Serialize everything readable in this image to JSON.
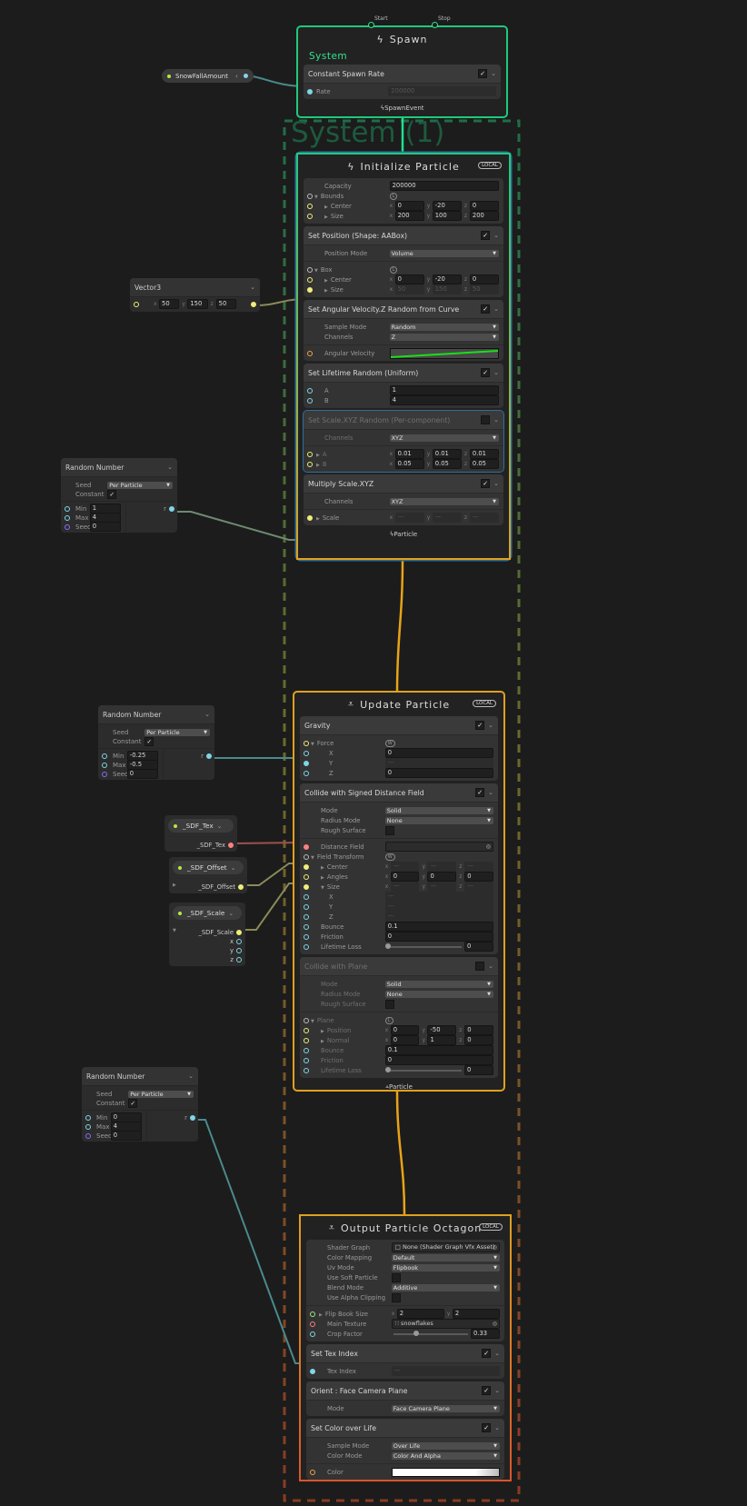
{
  "colors": {
    "flow_spawn": "#1fc97c",
    "flow_particle": "#e8a317",
    "output_bottom": "#d9552a",
    "float_port": "#7fd6e6",
    "vector_port": "#f0ee7a",
    "texture_port": "#ff8080",
    "uint_port": "#8a6cff",
    "vec2_port": "#9fe87a",
    "color_port": "#f5a04a",
    "group_port": "#bbbbbb",
    "selection": "#2f6f9a"
  },
  "system_group_title": "System (1)",
  "snowfall_property": {
    "label": "SnowFallAmount",
    "collapse_icon": "chevron-left-icon"
  },
  "spawn": {
    "title": "Spawn",
    "icon": "lightning-icon",
    "start_label": "Start",
    "stop_label": "Stop",
    "system_label": "System",
    "footer": "SpawnEvent",
    "blocks": [
      {
        "title": "Constant Spawn Rate",
        "enabled": true,
        "rows": [
          {
            "type": "field",
            "label": "Rate",
            "port": "#7fd6e6",
            "filled": true,
            "value": "200000",
            "dim": true
          }
        ]
      }
    ]
  },
  "initialize": {
    "title": "Initialize Particle",
    "icon": "lightning-icon",
    "badge": "LOCAL",
    "footer": "Particle",
    "blocks": [
      {
        "title": "",
        "rows": [
          {
            "type": "field",
            "label": "Capacity",
            "indent": 1,
            "value": "200000"
          },
          {
            "type": "group",
            "label": "Bounds",
            "port": "#bbbbbb",
            "space": "L"
          },
          {
            "type": "vec3",
            "label": "Center",
            "port": "#f0ee7a",
            "indent": 1,
            "expand": "right",
            "x": "0",
            "y": "-20",
            "z": "0"
          },
          {
            "type": "vec3",
            "label": "Size",
            "port": "#f0ee7a",
            "indent": 1,
            "expand": "right",
            "x": "200",
            "y": "100",
            "z": "200"
          }
        ]
      },
      {
        "title": "Set Position (Shape: AABox)",
        "enabled": true,
        "rows": [
          {
            "type": "dropdown",
            "label": "Position Mode",
            "indent": 1,
            "value": "Volume"
          },
          {
            "type": "sep"
          },
          {
            "type": "group",
            "label": "Box",
            "port": "#bbbbbb",
            "space": "L"
          },
          {
            "type": "vec3",
            "label": "Center",
            "port": "#f0ee7a",
            "indent": 1,
            "expand": "right",
            "x": "0",
            "y": "-20",
            "z": "0"
          },
          {
            "type": "vec3",
            "label": "Size",
            "port": "#f0ee7a",
            "filled": true,
            "indent": 1,
            "expand": "right",
            "x": "50",
            "y": "150",
            "z": "50",
            "dim": true
          }
        ]
      },
      {
        "title": "Set Angular Velocity.Z Random from Curve",
        "enabled": true,
        "rows": [
          {
            "type": "dropdown",
            "label": "Sample Mode",
            "indent": 1,
            "value": "Random"
          },
          {
            "type": "dropdown",
            "label": "Channels",
            "indent": 1,
            "value": "Z"
          },
          {
            "type": "sep"
          },
          {
            "type": "curve",
            "label": "Angular Velocity",
            "port": "#f5a04a",
            "indent": 1,
            "curve_color": "#19e019"
          }
        ]
      },
      {
        "title": "Set Lifetime Random (Uniform)",
        "enabled": true,
        "rows": [
          {
            "type": "field",
            "label": "A",
            "port": "#7fd6e6",
            "indent": 1,
            "value": "1"
          },
          {
            "type": "field",
            "label": "B",
            "port": "#7fd6e6",
            "indent": 1,
            "value": "4"
          }
        ]
      },
      {
        "title": "Set Scale.XYZ Random (Per-component)",
        "enabled": false,
        "selected": true,
        "rows": [
          {
            "type": "dropdown",
            "label": "Channels",
            "indent": 1,
            "value": "XYZ"
          },
          {
            "type": "sep"
          },
          {
            "type": "vec3",
            "label": "A",
            "port": "#f0ee7a",
            "expand": "right",
            "x": "0.01",
            "y": "0.01",
            "z": "0.01"
          },
          {
            "type": "vec3",
            "label": "B",
            "port": "#f0ee7a",
            "expand": "right",
            "x": "0.05",
            "y": "0.05",
            "z": "0.05"
          }
        ]
      },
      {
        "title": "Multiply Scale.XYZ",
        "enabled": true,
        "rows": [
          {
            "type": "dropdown",
            "label": "Channels",
            "indent": 1,
            "value": "XYZ"
          },
          {
            "type": "sep"
          },
          {
            "type": "vec3",
            "label": "Scale",
            "port": "#f0ee7a",
            "filled": true,
            "expand": "right",
            "x": "—",
            "y": "—",
            "z": "—",
            "dim": true
          }
        ]
      }
    ]
  },
  "update": {
    "title": "Update Particle",
    "icon": "particle-icon",
    "badge": "LOCAL",
    "footer": "Particle",
    "blocks": [
      {
        "title": "Gravity",
        "enabled": true,
        "rows": [
          {
            "type": "group",
            "label": "Force",
            "port": "#f0ee7a",
            "space": "W"
          },
          {
            "type": "field",
            "label": "X",
            "port": "#7fd6e6",
            "indent": 2,
            "value": "0"
          },
          {
            "type": "field",
            "label": "Y",
            "port": "#7fd6e6",
            "filled": true,
            "indent": 2,
            "value": "—",
            "dim": true
          },
          {
            "type": "field",
            "label": "Z",
            "port": "#7fd6e6",
            "indent": 2,
            "value": "0"
          }
        ]
      },
      {
        "title": "Collide with Signed Distance Field",
        "enabled": true,
        "rows": [
          {
            "type": "dropdown",
            "label": "Mode",
            "indent": 1,
            "value": "Solid"
          },
          {
            "type": "dropdown",
            "label": "Radius Mode",
            "indent": 1,
            "value": "None"
          },
          {
            "type": "checkbox",
            "label": "Rough Surface",
            "indent": 1,
            "checked": false
          },
          {
            "type": "sep"
          },
          {
            "type": "object",
            "label": "Distance Field",
            "port": "#ff8080",
            "filled": true,
            "indent": 1,
            "value": "",
            "dim": true
          },
          {
            "type": "group",
            "label": "Field Transform",
            "port": "#bbbbbb",
            "space": "W"
          },
          {
            "type": "vec3",
            "label": "Center",
            "port": "#f0ee7a",
            "filled": true,
            "indent": 1,
            "expand": "right",
            "x": "—",
            "y": "—",
            "z": "—",
            "dim": true
          },
          {
            "type": "vec3",
            "label": "Angles",
            "port": "#f0ee7a",
            "indent": 1,
            "expand": "right",
            "x": "0",
            "y": "0",
            "z": "0"
          },
          {
            "type": "vec3",
            "label": "Size",
            "port": "#f0ee7a",
            "filled": true,
            "indent": 1,
            "expand": "down",
            "x": "—",
            "y": "—",
            "z": "—",
            "dim": true
          },
          {
            "type": "field",
            "label": "X",
            "port": "#7fd6e6",
            "indent": 2,
            "value": "—",
            "dim": true
          },
          {
            "type": "field",
            "label": "Y",
            "port": "#7fd6e6",
            "indent": 2,
            "value": "—",
            "dim": true
          },
          {
            "type": "field",
            "label": "Z",
            "port": "#7fd6e6",
            "indent": 2,
            "value": "—",
            "dim": true
          },
          {
            "type": "field",
            "label": "Bounce",
            "port": "#7fd6e6",
            "indent": 1,
            "value": "0.1"
          },
          {
            "type": "field",
            "label": "Friction",
            "port": "#7fd6e6",
            "indent": 1,
            "value": "0"
          },
          {
            "type": "slider",
            "label": "Lifetime Loss",
            "port": "#7fd6e6",
            "indent": 1,
            "value": "0",
            "fraction": 0
          }
        ]
      },
      {
        "title": "Collide with Plane",
        "enabled": false,
        "rows": [
          {
            "type": "dropdown",
            "label": "Mode",
            "indent": 1,
            "value": "Solid"
          },
          {
            "type": "dropdown",
            "label": "Radius Mode",
            "indent": 1,
            "value": "None"
          },
          {
            "type": "checkbox",
            "label": "Rough Surface",
            "indent": 1,
            "checked": false
          },
          {
            "type": "sep"
          },
          {
            "type": "group",
            "label": "Plane",
            "port": "#bbbbbb",
            "space": "L"
          },
          {
            "type": "vec3",
            "label": "Position",
            "port": "#f0ee7a",
            "indent": 1,
            "expand": "right",
            "x": "0",
            "y": "-50",
            "z": "0"
          },
          {
            "type": "vec3",
            "label": "Normal",
            "port": "#f0ee7a",
            "indent": 1,
            "expand": "right",
            "x": "0",
            "y": "1",
            "z": "0"
          },
          {
            "type": "field",
            "label": "Bounce",
            "port": "#7fd6e6",
            "indent": 1,
            "value": "0.1"
          },
          {
            "type": "field",
            "label": "Friction",
            "port": "#7fd6e6",
            "indent": 1,
            "value": "0"
          },
          {
            "type": "slider",
            "label": "Lifetime Loss",
            "port": "#7fd6e6",
            "indent": 1,
            "value": "0",
            "fraction": 0
          }
        ]
      }
    ]
  },
  "output": {
    "title": "Output Particle Octagon",
    "icon": "particle-icon",
    "badge": "LOCAL",
    "blocks": [
      {
        "title": "",
        "rows": [
          {
            "type": "object",
            "label": "Shader Graph",
            "indent": 1,
            "value": "None (Shader Graph Vfx Asset)",
            "file_icon": "file-icon"
          },
          {
            "type": "dropdown",
            "label": "Color Mapping",
            "indent": 1,
            "value": "Default"
          },
          {
            "type": "dropdown",
            "label": "Uv Mode",
            "indent": 1,
            "value": "Flipbook"
          },
          {
            "type": "checkbox",
            "label": "Use Soft Particle",
            "indent": 1,
            "checked": false
          },
          {
            "type": "dropdown",
            "label": "Blend Mode",
            "indent": 1,
            "value": "Additive"
          },
          {
            "type": "checkbox",
            "label": "Use Alpha Clipping",
            "indent": 1,
            "checked": false
          },
          {
            "type": "sep"
          },
          {
            "type": "vec2",
            "label": "Flip Book Size",
            "port": "#9fe87a",
            "expand": "right",
            "x": "2",
            "y": "2"
          },
          {
            "type": "object",
            "label": "Main Texture",
            "port": "#ff8080",
            "indent": 1,
            "value": "snowflakes",
            "file_icon": "texture-icon"
          },
          {
            "type": "slider",
            "label": "Crop Factor",
            "port": "#7fd6e6",
            "indent": 1,
            "value": "0.33",
            "fraction": 0.33
          }
        ]
      },
      {
        "title": "Set Tex Index",
        "enabled": true,
        "rows": [
          {
            "type": "field",
            "label": "Tex Index",
            "port": "#7fd6e6",
            "filled": true,
            "indent": 1,
            "value": "—",
            "dim": true
          }
        ]
      },
      {
        "title": "Orient : Face Camera Plane",
        "enabled": true,
        "rows": [
          {
            "type": "dropdown",
            "label": "Mode",
            "indent": 1,
            "value": "Face Camera Plane"
          }
        ]
      },
      {
        "title": "Set Color over Life",
        "enabled": true,
        "rows": [
          {
            "type": "dropdown",
            "label": "Sample Mode",
            "indent": 1,
            "value": "Over Life"
          },
          {
            "type": "dropdown",
            "label": "Color Mode",
            "indent": 1,
            "value": "Color And Alpha"
          },
          {
            "type": "sep"
          },
          {
            "type": "gradient",
            "label": "Color",
            "port": "#f5a04a",
            "indent": 1
          }
        ]
      }
    ]
  },
  "vector3": {
    "title": "Vector3",
    "x": "50",
    "y": "150",
    "z": "50"
  },
  "random_numbers": [
    {
      "title": "Random Number",
      "seed_label": "Seed",
      "seed_value": "Per Particle",
      "constant_label": "Constant",
      "constant": true,
      "min_label": "Min",
      "min": "1",
      "max_label": "Max",
      "max": "4",
      "seed_in_label": "Seed",
      "seed_in": "0",
      "output": "r"
    },
    {
      "title": "Random Number",
      "seed_label": "Seed",
      "seed_value": "Per Particle",
      "constant_label": "Constant",
      "constant": true,
      "min_label": "Min",
      "min": "-0.25",
      "max_label": "Max",
      "max": "-0.5",
      "seed_in_label": "Seed",
      "seed_in": "0",
      "output": "r"
    },
    {
      "title": "Random Number",
      "seed_label": "Seed",
      "seed_value": "Per Particle",
      "constant_label": "Constant",
      "constant": true,
      "min_label": "Min",
      "min": "0",
      "max_label": "Max",
      "max": "4",
      "seed_in_label": "Seed",
      "seed_in": "0",
      "output": "r"
    }
  ],
  "sdf_properties": [
    {
      "name": "_SDF_Tex",
      "outputs": [
        "_SDF_Tex"
      ],
      "port": "#ff8080"
    },
    {
      "name": "_SDF_Offset",
      "outputs": [
        "_SDF_Offset"
      ],
      "port": "#f0ee7a"
    },
    {
      "name": "_SDF_Scale",
      "outputs": [
        "_SDF_Scale",
        "x",
        "y",
        "z"
      ],
      "port": "#f0ee7a"
    }
  ]
}
